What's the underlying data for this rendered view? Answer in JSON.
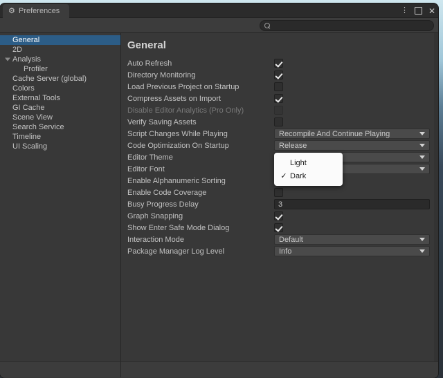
{
  "window": {
    "tab_label": "Preferences",
    "tab_icon": "gear-icon",
    "controls": {
      "menu": "⋮",
      "maximize": "maximize",
      "close": "✕"
    }
  },
  "search": {
    "placeholder": "",
    "value": "",
    "icon": "search-icon"
  },
  "sidebar": {
    "items": [
      {
        "label": "General",
        "selected": true,
        "indent": false,
        "foldout": false
      },
      {
        "label": "2D",
        "selected": false,
        "indent": false,
        "foldout": false
      },
      {
        "label": "Analysis",
        "selected": false,
        "indent": false,
        "foldout": true
      },
      {
        "label": "Profiler",
        "selected": false,
        "indent": true,
        "foldout": false
      },
      {
        "label": "Cache Server (global)",
        "selected": false,
        "indent": false,
        "foldout": false
      },
      {
        "label": "Colors",
        "selected": false,
        "indent": false,
        "foldout": false
      },
      {
        "label": "External Tools",
        "selected": false,
        "indent": false,
        "foldout": false
      },
      {
        "label": "GI Cache",
        "selected": false,
        "indent": false,
        "foldout": false
      },
      {
        "label": "Scene View",
        "selected": false,
        "indent": false,
        "foldout": false
      },
      {
        "label": "Search Service",
        "selected": false,
        "indent": false,
        "foldout": false
      },
      {
        "label": "Timeline",
        "selected": false,
        "indent": false,
        "foldout": false
      },
      {
        "label": "UI Scaling",
        "selected": false,
        "indent": false,
        "foldout": false
      }
    ]
  },
  "main": {
    "title": "General",
    "rows": [
      {
        "label": "Auto Refresh",
        "type": "checkbox",
        "checked": true,
        "disabled": false
      },
      {
        "label": "Directory Monitoring",
        "type": "checkbox",
        "checked": true,
        "disabled": false
      },
      {
        "label": "Load Previous Project on Startup",
        "type": "checkbox",
        "checked": false,
        "disabled": false
      },
      {
        "label": "Compress Assets on Import",
        "type": "checkbox",
        "checked": true,
        "disabled": false
      },
      {
        "label": "Disable Editor Analytics (Pro Only)",
        "type": "checkbox",
        "checked": false,
        "disabled": true
      },
      {
        "label": "Verify Saving Assets",
        "type": "checkbox",
        "checked": false,
        "disabled": false
      },
      {
        "label": "Script Changes While Playing",
        "type": "dropdown",
        "value": "Recompile And Continue Playing",
        "disabled": false
      },
      {
        "label": "Code Optimization On Startup",
        "type": "dropdown",
        "value": "Release",
        "disabled": false
      },
      {
        "label": "Editor Theme",
        "type": "dropdown",
        "value": "Dark",
        "disabled": false
      },
      {
        "label": "Editor Font",
        "type": "dropdown",
        "value": "",
        "disabled": false
      },
      {
        "label": "Enable Alphanumeric Sorting",
        "type": "checkbox",
        "checked": false,
        "disabled": false
      },
      {
        "label": "Enable Code Coverage",
        "type": "checkbox",
        "checked": false,
        "disabled": false
      },
      {
        "label": "Busy Progress Delay",
        "type": "text",
        "value": "3",
        "disabled": false
      },
      {
        "label": "Graph Snapping",
        "type": "checkbox",
        "checked": true,
        "disabled": false
      },
      {
        "label": "Show Enter Safe Mode Dialog",
        "type": "checkbox",
        "checked": true,
        "disabled": false
      },
      {
        "label": "Interaction Mode",
        "type": "dropdown",
        "value": "Default",
        "disabled": false
      },
      {
        "label": "Package Manager Log Level",
        "type": "dropdown",
        "value": "Info",
        "disabled": false
      }
    ]
  },
  "popup": {
    "open": true,
    "owner": "Editor Theme",
    "items": [
      {
        "label": "Light",
        "checked": false
      },
      {
        "label": "Dark",
        "checked": true
      }
    ],
    "check_glyph": "✓"
  },
  "colors": {
    "selection": "#2c5d87",
    "panel": "#383838",
    "popup_bg": "#fbfbfb"
  }
}
